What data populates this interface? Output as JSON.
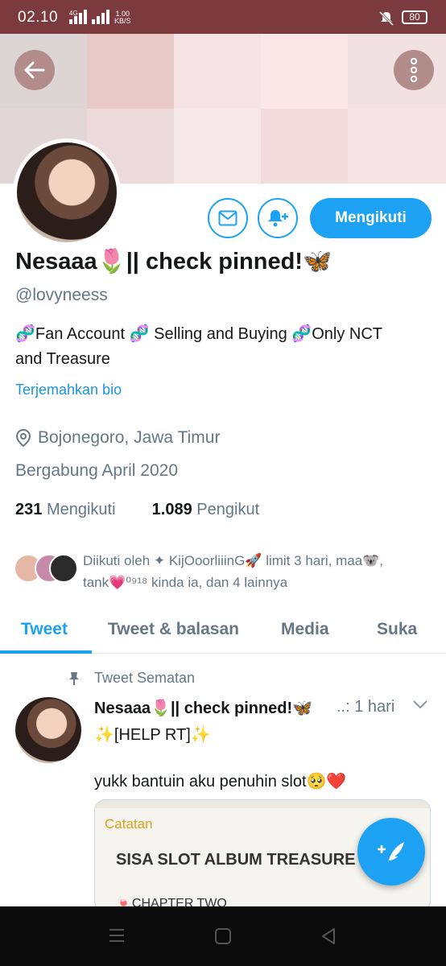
{
  "status_bar": {
    "time": "02.10",
    "network": "4G",
    "speed_value": "1.00",
    "speed_unit": "KB/S",
    "battery": "80"
  },
  "header": {
    "back_icon": "arrow-left-icon",
    "menu_icon": "more-vertical-icon"
  },
  "profile": {
    "name": "Nesaaa🌷|| check pinned!🦋",
    "handle": "@lovyneess",
    "bio_line1": "🧬Fan Account 🧬 Selling and Buying 🧬Only NCT",
    "bio_line2": "and Treasure",
    "translate_bio": "Terjemahkan bio",
    "location": "Bojonegoro, Jawa Timur",
    "joined": "Bergabung April 2020",
    "following_count": "231",
    "following_label": "Mengikuti",
    "followers_count": "1.089",
    "followers_label": "Pengikut",
    "followed_by_line1": "Diikuti oleh ✦ KijOoorliiinG🚀 limit 3 hari, maa🐨,",
    "followed_by_line2": "tank💗⁰⁹¹⁸ kinda ia, dan 4 lainnya",
    "follow_button": "Mengikuti",
    "accent_color": "#1da1f2"
  },
  "tabs": [
    {
      "label": "Tweet",
      "active": true
    },
    {
      "label": "Tweet & balasan",
      "active": false
    },
    {
      "label": "Media",
      "active": false
    },
    {
      "label": "Suka",
      "active": false
    }
  ],
  "pinned_tweet": {
    "pinned_label": "Tweet Sematan",
    "author": "Nesaaa🌷|| check pinned!🦋",
    "time": "..: 1 hari",
    "line1": "✨[HELP RT]✨",
    "line2": "yukk bantuin aku penuhin slot🥺❤️",
    "media": {
      "back_label": "Catatan",
      "title": "SISA SLOT ALBUM TREASURE",
      "item": "🍬CHAPTER TWO"
    }
  }
}
